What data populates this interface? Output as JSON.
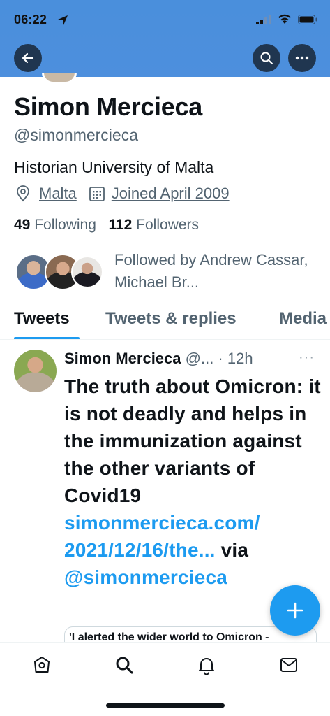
{
  "status_bar": {
    "time": "06:22"
  },
  "profile": {
    "name": "Simon Mercieca",
    "handle": "@simonmercieca",
    "bio": "Historian University of Malta",
    "location": "Malta",
    "joined": "Joined April 2009",
    "following_count": "49",
    "following_label": "Following",
    "followers_count": "112",
    "followers_label": "Followers",
    "followed_by": "Followed by Andrew Cassar, Michael Br..."
  },
  "tabs": [
    {
      "label": "Tweets",
      "active": true
    },
    {
      "label": "Tweets & replies",
      "active": false
    },
    {
      "label": "Media",
      "active": false
    }
  ],
  "tweet": {
    "author": "Simon Mercieca",
    "handle_time": "@... · 12h",
    "more": "···",
    "text": "The truth about Omicron: it is not deadly and helps in the immunization against the other variants of Covid19",
    "link": "simonmercieca.com/ 2021/12/16/the...",
    "via": "via",
    "mention": "@simonmercieca",
    "card_preview": "'I alerted the wider world to Omicron -"
  },
  "icons": {
    "back": "back-arrow-icon",
    "search": "search-icon",
    "more": "more-icon",
    "compose": "plus-icon",
    "nav": [
      "home-icon",
      "search-icon",
      "notifications-icon",
      "messages-icon"
    ]
  },
  "colors": {
    "header": "#4d8fdd",
    "accent": "#1d9bf0",
    "text_secondary": "#536471"
  }
}
